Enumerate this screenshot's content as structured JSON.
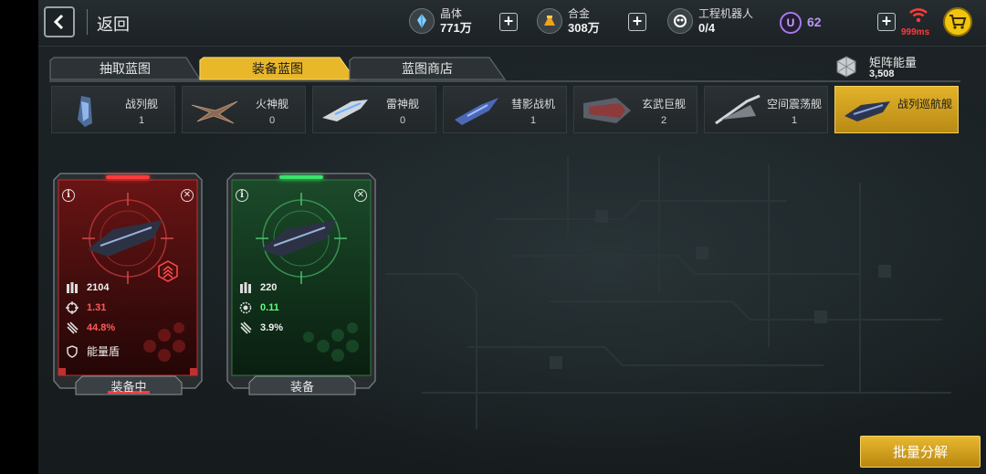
{
  "topbar": {
    "back_label": "返回",
    "crystal": {
      "label": "晶体",
      "value": "771万"
    },
    "alloy": {
      "label": "合金",
      "value": "308万"
    },
    "robot": {
      "label": "工程机器人",
      "value": "0/4"
    },
    "u_letter": "U",
    "u_value": "62",
    "ping": "999ms"
  },
  "tabs": [
    {
      "label": "抽取蓝图",
      "active": false
    },
    {
      "label": "装备蓝图",
      "active": true
    },
    {
      "label": "蓝图商店",
      "active": false
    }
  ],
  "matrix": {
    "label": "矩阵能量",
    "value": "3,508"
  },
  "ships": [
    {
      "name": "战列舰",
      "count": "1"
    },
    {
      "name": "火神舰",
      "count": "0"
    },
    {
      "name": "雷神舰",
      "count": "0"
    },
    {
      "name": "彗影战机",
      "count": "1"
    },
    {
      "name": "玄武巨舰",
      "count": "2"
    },
    {
      "name": "空间震荡舰",
      "count": "1"
    },
    {
      "name": "战列巡航舰",
      "count": "",
      "active": true
    }
  ],
  "cards": [
    {
      "theme": "red",
      "info": "i",
      "stats": [
        "2104",
        "1.31",
        "44.8%",
        "能量盾"
      ],
      "stat_colors": [
        "#f0f0f0",
        "#ff5a5a",
        "#ff5a5a",
        "#f0f0f0"
      ],
      "button": "装备中"
    },
    {
      "theme": "green",
      "info": "i",
      "stats": [
        "220",
        "0.11",
        "3.9%"
      ],
      "stat_colors": [
        "#f0f0f0",
        "#5dff7a",
        "#f0f0f0"
      ],
      "button": "装备"
    }
  ],
  "bulk_button": "批量分解",
  "colors": {
    "accent": "#e2b22a",
    "red": "#ff5a5a",
    "green": "#5dff7a",
    "purple": "#b795f5"
  }
}
